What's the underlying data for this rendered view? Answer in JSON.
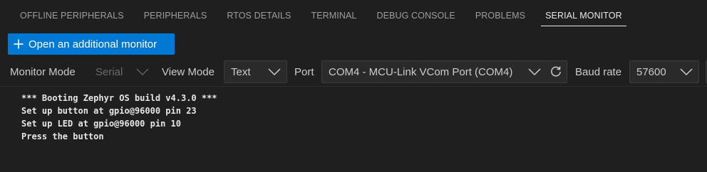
{
  "tabs": [
    {
      "label": "OFFLINE PERIPHERALS",
      "active": false
    },
    {
      "label": "PERIPHERALS",
      "active": false
    },
    {
      "label": "RTOS DETAILS",
      "active": false
    },
    {
      "label": "TERMINAL",
      "active": false
    },
    {
      "label": "DEBUG CONSOLE",
      "active": false
    },
    {
      "label": "PROBLEMS",
      "active": false
    },
    {
      "label": "SERIAL MONITOR",
      "active": true
    }
  ],
  "open_button": {
    "label": "Open an additional monitor",
    "icon": "plus-icon"
  },
  "controls": {
    "monitor_mode_label": "Monitor Mode",
    "monitor_mode_value": "Serial",
    "view_mode_label": "View Mode",
    "view_mode_value": "Text",
    "port_label": "Port",
    "port_value": "COM4 - MCU-Link VCom Port (COM4)",
    "baud_label": "Baud rate",
    "baud_value": "57600"
  },
  "output_lines": [
    "*** Booting Zephyr OS build v4.3.0 ***",
    "Set up button at gpio@96000 pin 23",
    "Set up LED at gpio@96000 pin 10",
    "Press the button"
  ],
  "colors": {
    "background": "#1f1f1f",
    "accent": "#0078d4",
    "active_tab": "#e7e7e7",
    "inactive_tab": "#9d9d9d"
  }
}
